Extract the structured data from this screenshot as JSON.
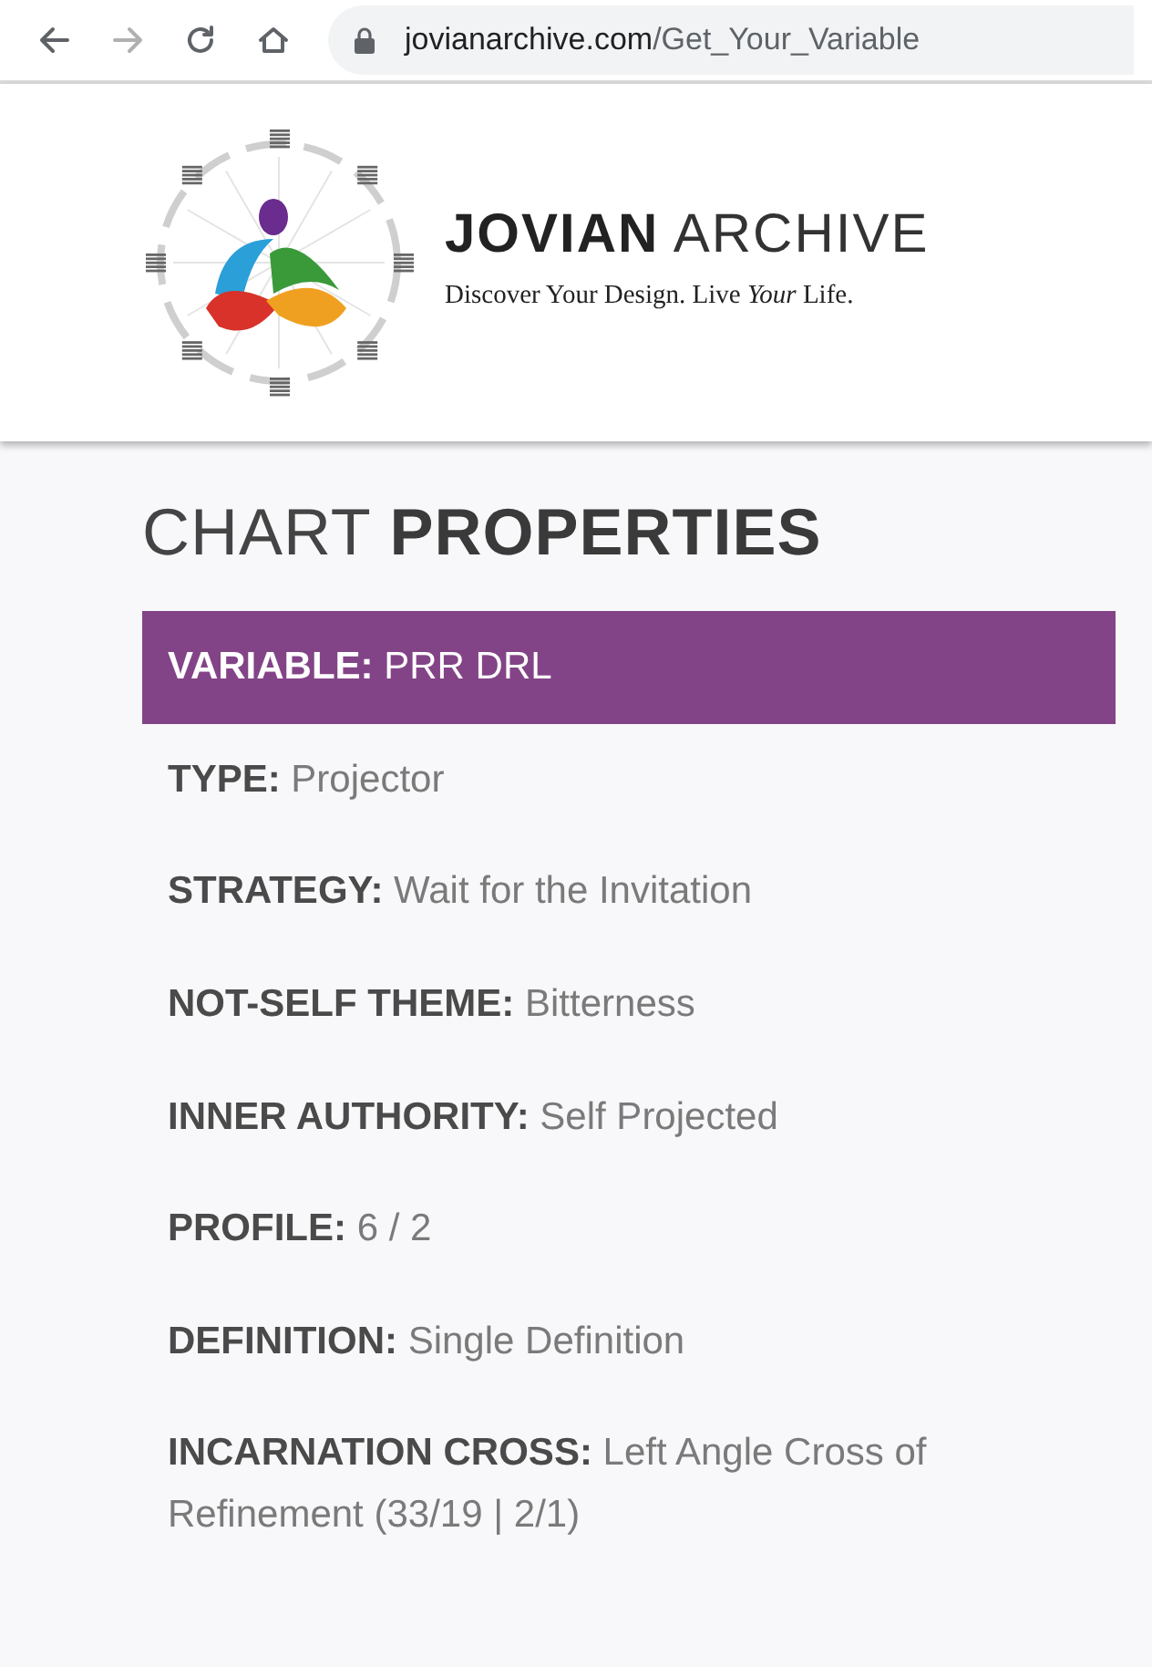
{
  "browser": {
    "back_disabled": false,
    "forward_disabled": true,
    "url_host": "jovianarchive.com",
    "url_path": "/Get_Your_Variable"
  },
  "logo": {
    "brand_bold": "JOVIAN",
    "brand_light": "ARCHIVE",
    "tagline": "Discover Your Design. Live *Your* Life."
  },
  "heading": {
    "light": "CHART",
    "bold": "PROPERTIES"
  },
  "properties": [
    {
      "text": "**VARIABLE:** PRR DRL",
      "highlighted": true
    },
    {
      "text": "**TYPE:** Projector",
      "highlighted": false
    },
    {
      "text": "**STRATEGY:** Wait for the Invitation",
      "highlighted": false
    },
    {
      "text": "**NOT-SELF THEME:** Bitterness",
      "highlighted": false
    },
    {
      "text": "**INNER AUTHORITY:** Self Projected",
      "highlighted": false
    },
    {
      "text": "**PROFILE:** 6 / 2",
      "highlighted": false
    },
    {
      "text": "**DEFINITION:** Single Definition",
      "highlighted": false
    },
    {
      "text": "**INCARNATION CROSS:** Left Angle Cross of Refinement (33/19 | 2/1)",
      "highlighted": false
    }
  ]
}
